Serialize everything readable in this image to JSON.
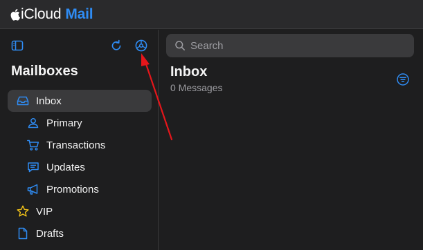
{
  "app": {
    "title_prefix": "iCloud",
    "title_suffix": "Mail",
    "brand_color": "#2f8cf4"
  },
  "sidebar": {
    "title": "Mailboxes",
    "toolbar": {
      "toggle_icon": "sidebar-toggle-icon",
      "refresh_icon": "refresh-icon",
      "settings_icon": "gear-icon"
    },
    "items": [
      {
        "label": "Inbox",
        "icon": "inbox-tray-icon",
        "selected": true
      },
      {
        "label": "Primary",
        "icon": "person-icon"
      },
      {
        "label": "Transactions",
        "icon": "cart-icon"
      },
      {
        "label": "Updates",
        "icon": "message-bubble-icon"
      },
      {
        "label": "Promotions",
        "icon": "megaphone-icon"
      },
      {
        "label": "VIP",
        "icon": "star-icon"
      },
      {
        "label": "Drafts",
        "icon": "document-icon"
      }
    ]
  },
  "main": {
    "search": {
      "placeholder": "Search"
    },
    "title": "Inbox",
    "count": "0 Messages",
    "filter_icon": "filter-icon"
  },
  "annotation": {
    "arrow_color": "#e5161b",
    "points_to": "gear-icon"
  }
}
